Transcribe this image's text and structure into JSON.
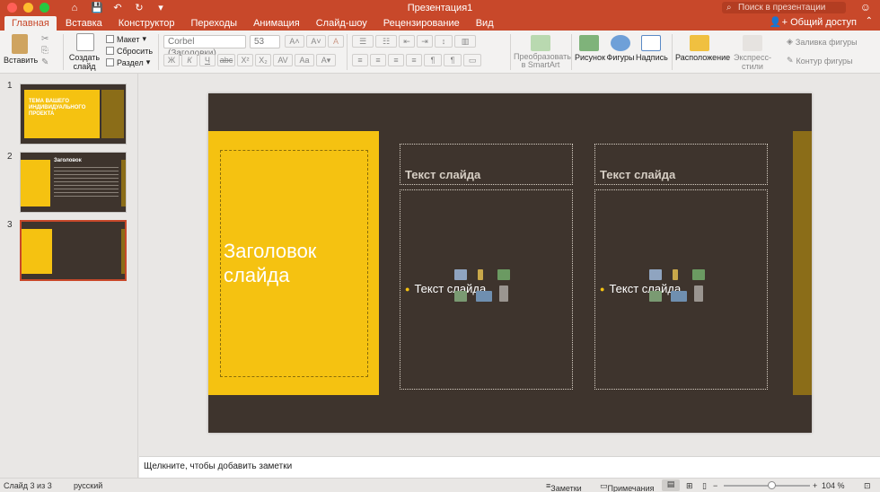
{
  "window": {
    "title": "Презентация1",
    "search_placeholder": "Поиск в презентации",
    "quick_access": [
      "⌂",
      "💾",
      "↶",
      "↻",
      "▾"
    ]
  },
  "tabs": [
    "Главная",
    "Вставка",
    "Конструктор",
    "Переходы",
    "Анимация",
    "Слайд-шоу",
    "Рецензирование",
    "Вид"
  ],
  "share_label": "Общий доступ",
  "ribbon": {
    "paste": "Вставить",
    "new_slide": "Создать слайд",
    "layout": "Макет",
    "reset": "Сбросить",
    "section": "Раздел",
    "font_name": "Corbel (Заголовки)",
    "font_size": "53",
    "format_buttons": [
      "Ж",
      "К",
      "Ч",
      "abc",
      "X²",
      "X₂",
      "AV",
      "Aa"
    ],
    "smartart": "Преобразовать в SmartArt",
    "picture": "Рисунок",
    "shapes": "Фигуры",
    "textbox": "Надпись",
    "arrange": "Расположение",
    "quick_styles": "Экспресс-стили",
    "shape_fill": "Заливка фигуры",
    "shape_outline": "Контур фигуры"
  },
  "thumbnails": [
    {
      "number": "1",
      "title": "ТЕМА ВАШЕГО ИНДИВИДУАЛЬНОГО ПРОЕКТА"
    },
    {
      "number": "2",
      "title": "Заголовок"
    },
    {
      "number": "3",
      "title": ""
    }
  ],
  "slide": {
    "title": "Заголовок слайда",
    "left_header": "Текст слайда",
    "left_body": "Текст слайда",
    "right_header": "Текст слайда",
    "right_body": "Текст слайда"
  },
  "colors": {
    "accent": "#c8482a",
    "slide_bg": "#3e342d",
    "yellow": "#f5c211",
    "gold_bar": "#8b6d18"
  },
  "notes_placeholder": "Щелкните, чтобы добавить заметки",
  "status": {
    "slide_counter": "Слайд 3 из 3",
    "language": "русский",
    "notes_button": "Заметки",
    "comments_button": "Примечания",
    "zoom": "104 %"
  }
}
